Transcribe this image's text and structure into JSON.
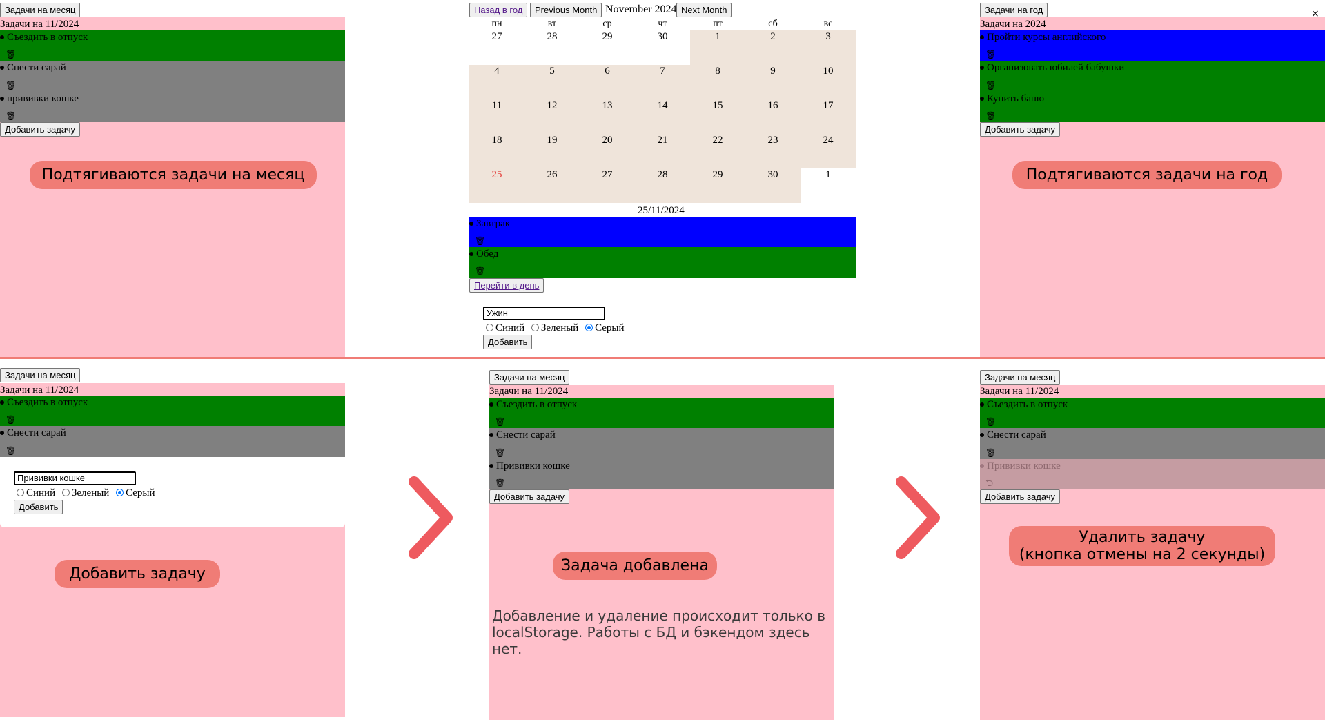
{
  "top": {
    "month_tasks": {
      "button": "Задачи на месяц",
      "header": "Задачи на 11/2024",
      "tasks": [
        {
          "text": "Съездить в отпуск",
          "color": "#008000"
        },
        {
          "text": "Снести сарай",
          "color": "#808080"
        },
        {
          "text": "прививки кошке",
          "color": "#808080"
        }
      ],
      "add_button": "Добавить задачу",
      "caption": "Подтягиваются задачи на месяц"
    },
    "calendar": {
      "back_button": "Назад в год",
      "prev_button": "Previous Month",
      "title": "November 2024",
      "next_button": "Next Month",
      "weekdays": [
        "пн",
        "вт",
        "ср",
        "чт",
        "пт",
        "сб",
        "вс"
      ],
      "weeks": [
        [
          "27",
          "28",
          "29",
          "30",
          "1",
          "2",
          "3"
        ],
        [
          "4",
          "5",
          "6",
          "7",
          "8",
          "9",
          "10"
        ],
        [
          "11",
          "12",
          "13",
          "14",
          "15",
          "16",
          "17"
        ],
        [
          "18",
          "19",
          "20",
          "21",
          "22",
          "23",
          "24"
        ],
        [
          "25",
          "26",
          "27",
          "28",
          "29",
          "30",
          "1"
        ]
      ],
      "today": "25",
      "today_color": "#e53935",
      "selected_date": "25/11/2024",
      "day_tasks": [
        {
          "text": "Завтрак",
          "color": "#0000ff"
        },
        {
          "text": "Обед",
          "color": "#008000"
        }
      ],
      "goto_day_button": "Перейти в день",
      "new_task_value": "Ужин",
      "radio_options": [
        "Синий",
        "Зеленый",
        "Серый"
      ],
      "radio_selected": "Серый",
      "add_button": "Добавить"
    },
    "year_tasks": {
      "button": "Задачи на год",
      "close_glyph": "×",
      "header": "Задачи на 2024",
      "tasks": [
        {
          "text": "Пройти курсы английского",
          "color": "#0000ff"
        },
        {
          "text": "Организовать юбилей бабушки",
          "color": "#008000"
        },
        {
          "text": "Купить баню",
          "color": "#008000"
        }
      ],
      "add_button": "Добавить задачу",
      "caption": "Подтягиваются задачи на год"
    }
  },
  "bottom": {
    "step1": {
      "button": "Задачи на месяц",
      "header": "Задачи на 11/2024",
      "tasks": [
        {
          "text": "Съездить в отпуск",
          "color": "#008000"
        },
        {
          "text": "Снести сарай",
          "color": "#808080"
        }
      ],
      "input_value": "Прививки кошке",
      "radio_options": [
        "Синий",
        "Зеленый",
        "Серый"
      ],
      "radio_selected": "Серый",
      "add_button": "Добавить",
      "caption": "Добавить задачу"
    },
    "step2": {
      "button": "Задачи на месяц",
      "header": "Задачи на 11/2024",
      "tasks": [
        {
          "text": "Съездить в отпуск",
          "color": "#008000"
        },
        {
          "text": "Снести сарай",
          "color": "#808080"
        },
        {
          "text": "Прививки кошке",
          "color": "#808080"
        }
      ],
      "add_button": "Добавить задачу",
      "caption": "Задача добавлена",
      "note": "Добавление и удаление происходит только в localStorage. Работы с БД и бэкендом здесь нет."
    },
    "step3": {
      "button": "Задачи на месяц",
      "header": "Задачи на 11/2024",
      "tasks": [
        {
          "text": "Съездить в отпуск",
          "color": "#008000"
        },
        {
          "text": "Снести сарай",
          "color": "#808080"
        },
        {
          "text": "Прививки кошке",
          "color": "#c59ca2"
        }
      ],
      "add_button": "Добавить задачу",
      "caption_line1": "Удалить задачу",
      "caption_line2": "(кнопка отмены на 2 секунды)"
    }
  },
  "icons": {
    "trash": "trash-icon",
    "undo": "undo-icon",
    "arrow": "chevron-right-icon"
  },
  "colors": {
    "panel": "#ffc0cb",
    "caption": "#f07c76",
    "divider": "#f07c76",
    "calendar_cell": "#efe4da"
  }
}
